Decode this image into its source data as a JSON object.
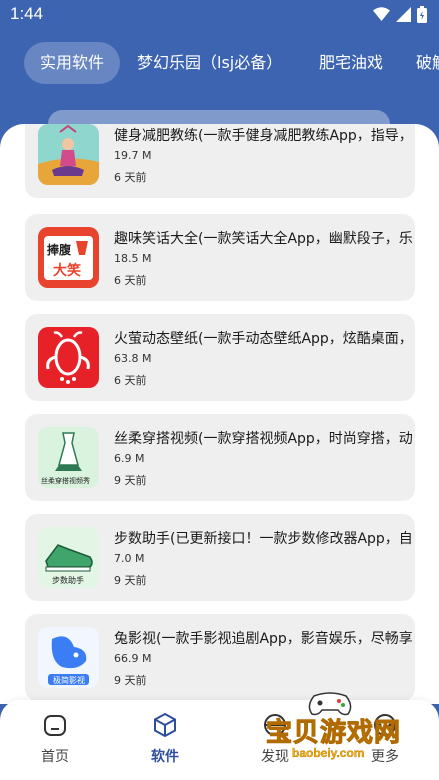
{
  "status": {
    "time": "1:44"
  },
  "tabs": [
    {
      "label": "实用软件",
      "active": true
    },
    {
      "label": "梦幻乐园（lsj必备）",
      "active": false
    },
    {
      "label": "肥宅油戏",
      "active": false
    },
    {
      "label": "破解",
      "active": false
    }
  ],
  "apps": [
    {
      "title": "健身减肥教练(一款手健身减肥教练App，指导，",
      "size": "19.7 M",
      "time": "6 天前",
      "icon": "fitness-icon"
    },
    {
      "title": "趣味笑话大全(一款笑话大全App，幽默段子，乐",
      "size": "18.5 M",
      "time": "6 天前",
      "icon": "jokes-icon",
      "icon_text_top": "捧腹",
      "icon_text_bottom": "大笑"
    },
    {
      "title": "火萤动态壁纸(一款手动态壁纸App，炫酷桌面，",
      "size": "63.8 M",
      "time": "6 天前",
      "icon": "firefly-icon"
    },
    {
      "title": "丝柔穿搭视频(一款穿搭视频App，时尚穿搭，动",
      "size": "6.9 M",
      "time": "9 天前",
      "icon": "dress-icon",
      "icon_caption": "丝柔穿搭视频秀"
    },
    {
      "title": "步数助手(已更新接口！一款步数修改器App，自",
      "size": "7.0 M",
      "time": "9 天前",
      "icon": "sneaker-icon",
      "icon_caption": "步数助手"
    },
    {
      "title": "兔影视(一款手影视追剧App，影音娱乐，尽畅享",
      "size": "66.9 M",
      "time": "9 天前",
      "icon": "rabbit-video-icon",
      "icon_caption": "极简影视"
    }
  ],
  "nav": [
    {
      "label": "首页",
      "icon": "home-icon",
      "active": false
    },
    {
      "label": "软件",
      "icon": "cube-icon",
      "active": true
    },
    {
      "label": "发现",
      "icon": "discover-icon",
      "active": false
    },
    {
      "label": "更多",
      "icon": "more-icon",
      "active": false
    }
  ],
  "watermark": {
    "text": "宝贝游戏网",
    "url": "baobeiy.com"
  },
  "colors": {
    "header": "#3d64b1",
    "active_nav": "#2e4fa0",
    "card": "#efefef"
  }
}
